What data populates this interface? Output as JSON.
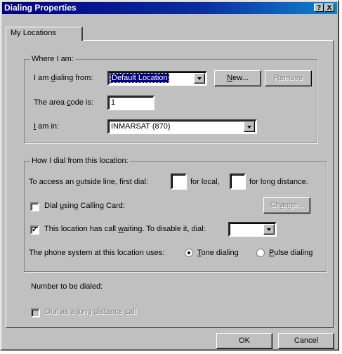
{
  "window": {
    "title": "Dialing Properties",
    "help_button": "?",
    "close_button": "X"
  },
  "tabs": [
    {
      "label": "My Locations"
    }
  ],
  "where": {
    "legend": "Where I am:",
    "dialing_from_label": "I am dialing from:",
    "dialing_from_value": "Default Location",
    "new_button": "New...",
    "remove_button": "Remove",
    "area_code_label": "The area code is:",
    "area_code_value": "1",
    "i_am_in_label": "I am in:",
    "i_am_in_value": "INMARSAT (870)"
  },
  "how": {
    "legend": "How I dial from this location:",
    "outside_line_label": "To access an outside line, first dial:",
    "local_value": "",
    "for_local_label": "for local,",
    "long_distance_value": "",
    "for_long_distance_label": "for long distance.",
    "calling_card_label": "Dial using Calling Card:",
    "calling_card_checked": false,
    "change_button": "Change...",
    "call_waiting_label": "This location has call waiting. To disable it, dial:",
    "call_waiting_checked": true,
    "call_waiting_value": "",
    "phone_system_label": "The phone system at this location uses:",
    "tone_label": "Tone dialing",
    "pulse_label": "Pulse dialing",
    "selected": "tone"
  },
  "number_label": "Number to be dialed:",
  "long_distance_call_label": "Dial as a long distance call",
  "ok_button": "OK",
  "cancel_button": "Cancel"
}
